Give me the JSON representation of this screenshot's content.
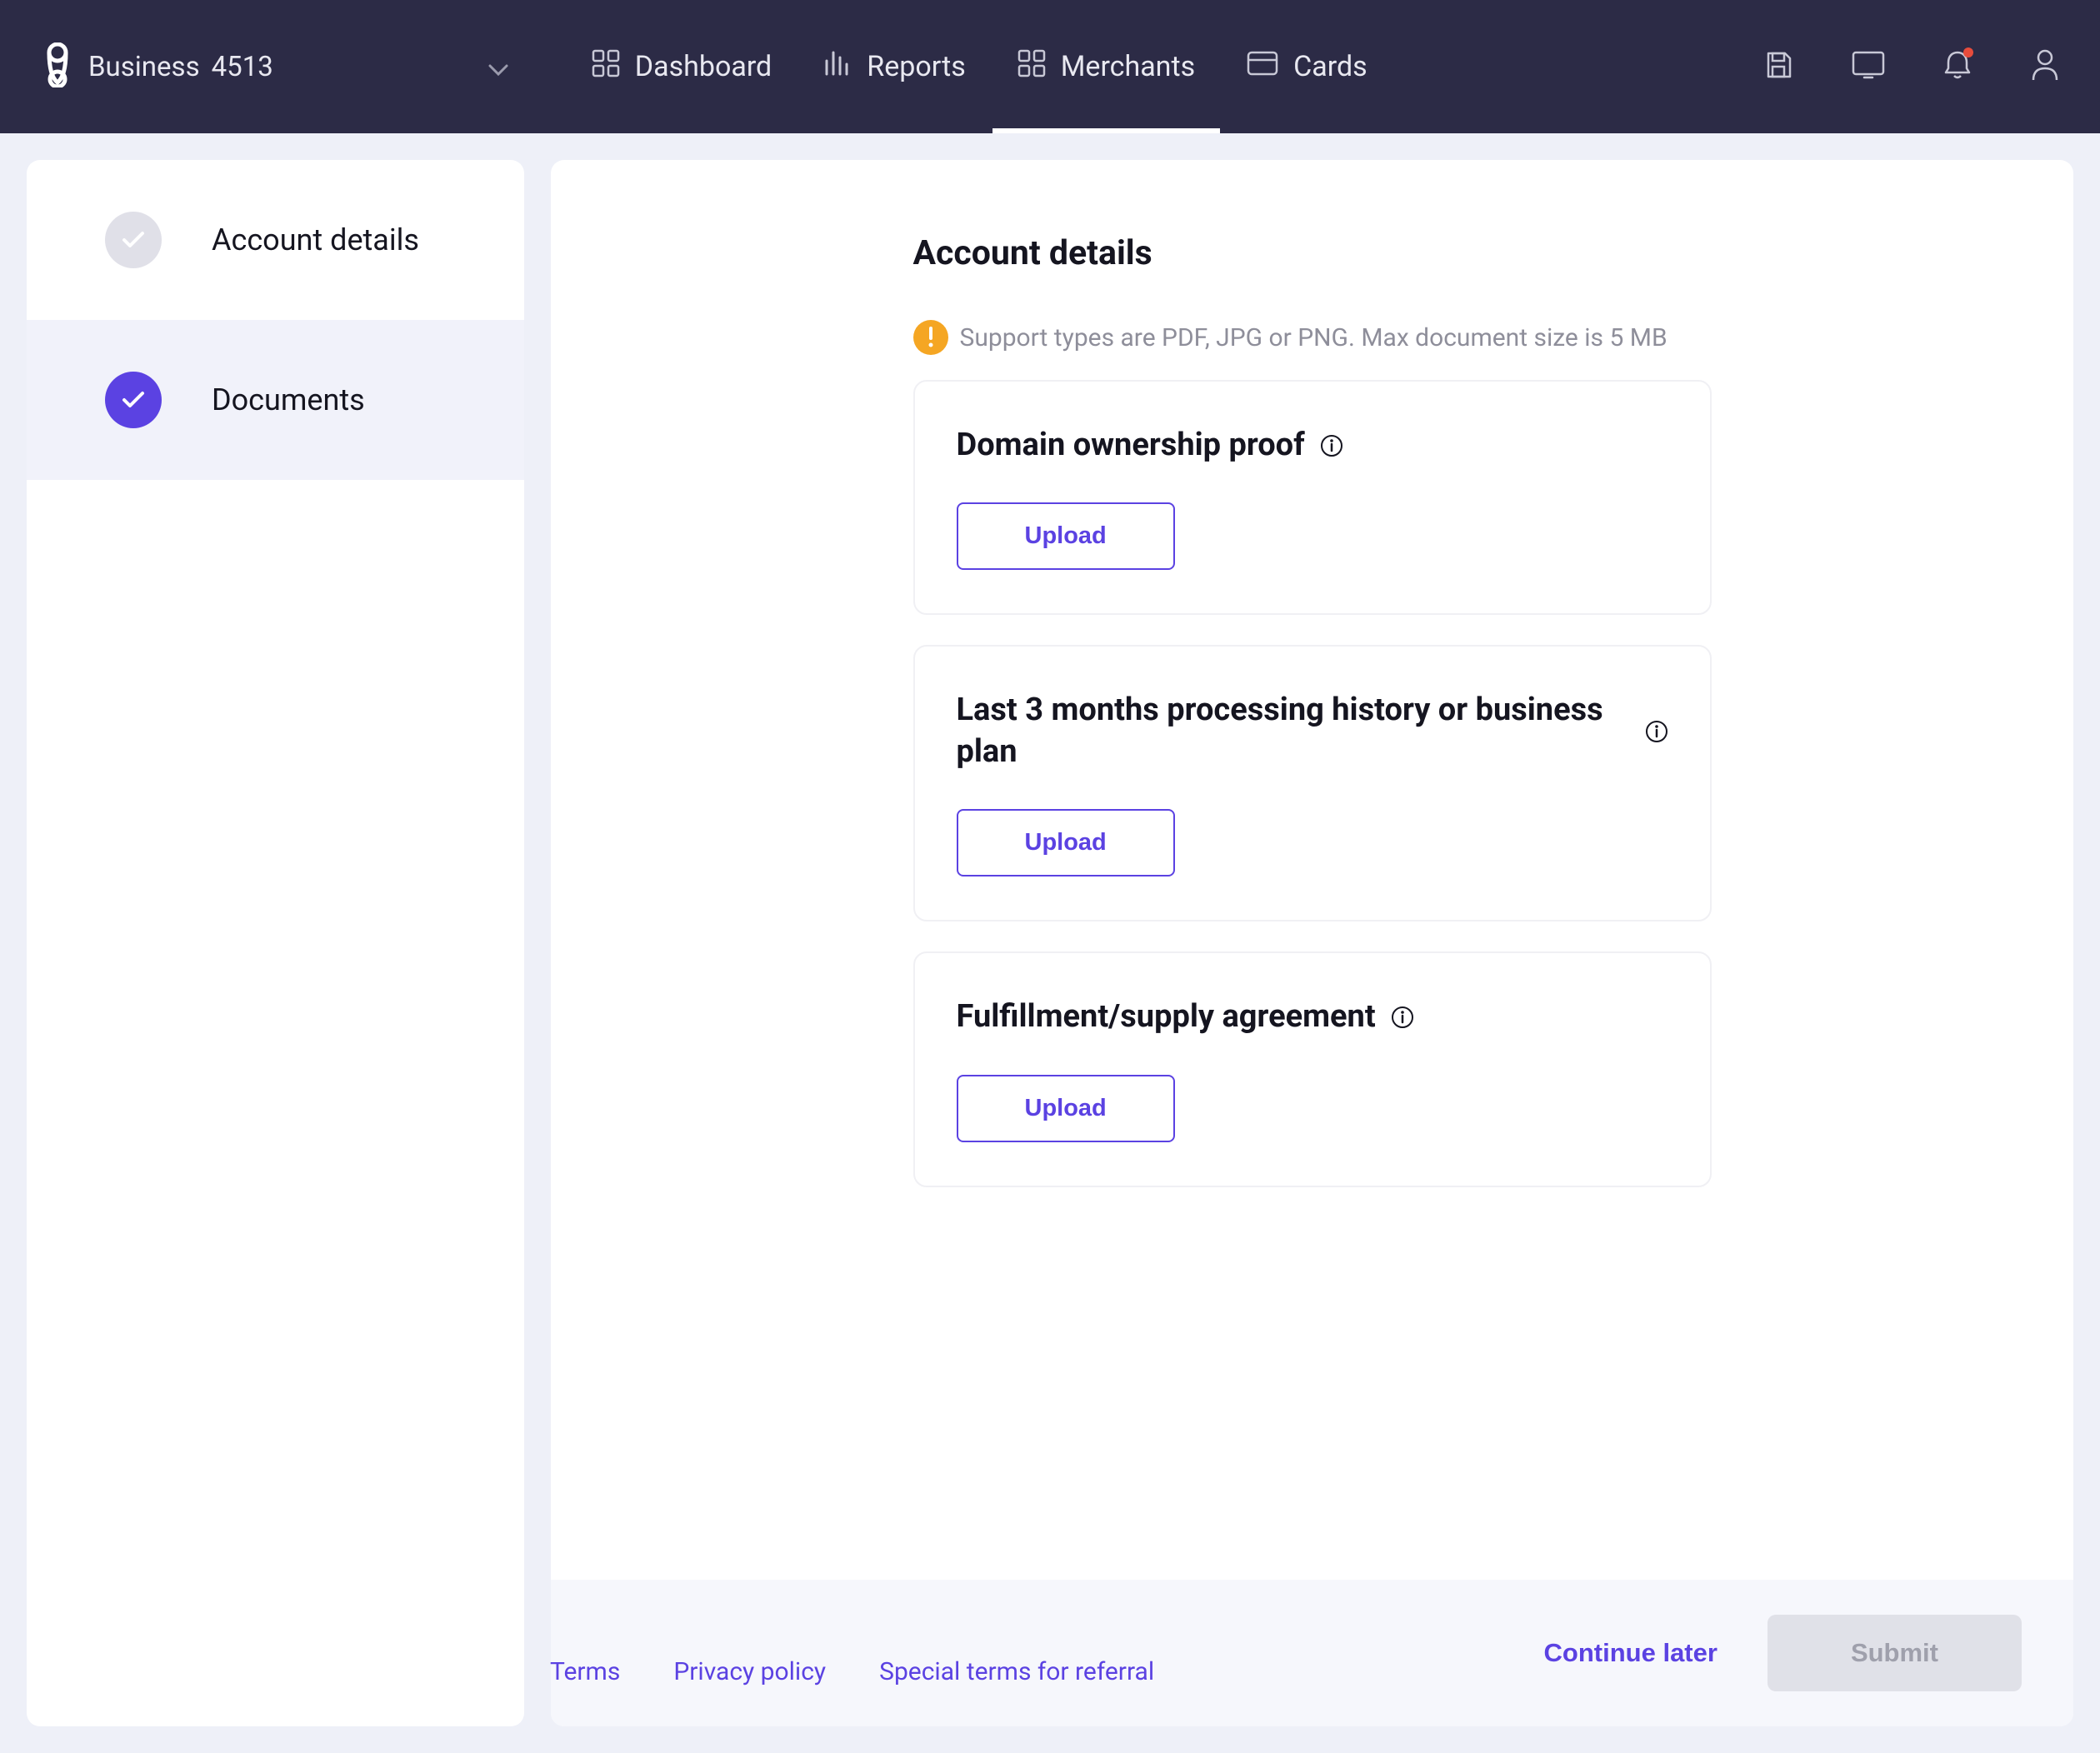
{
  "header": {
    "business_label": "Business",
    "business_id": "4513",
    "nav": {
      "dashboard": "Dashboard",
      "reports": "Reports",
      "merchants": "Merchants",
      "cards": "Cards"
    }
  },
  "sidebar": {
    "items": [
      {
        "label": "Account details"
      },
      {
        "label": "Documents"
      }
    ]
  },
  "page": {
    "title": "Account details",
    "info_text": "Support types are PDF, JPG or PNG. Max document size is 5 MB",
    "cards": [
      {
        "title": "Domain ownership proof",
        "button": "Upload"
      },
      {
        "title": "Last 3 months processing history or business plan",
        "button": "Upload"
      },
      {
        "title": "Fulfillment/supply agreement",
        "button": "Upload"
      }
    ]
  },
  "actions": {
    "continue_later": "Continue later",
    "submit": "Submit"
  },
  "footer": {
    "terms": "Terms",
    "privacy": "Privacy policy",
    "referral": "Special terms for referral"
  }
}
